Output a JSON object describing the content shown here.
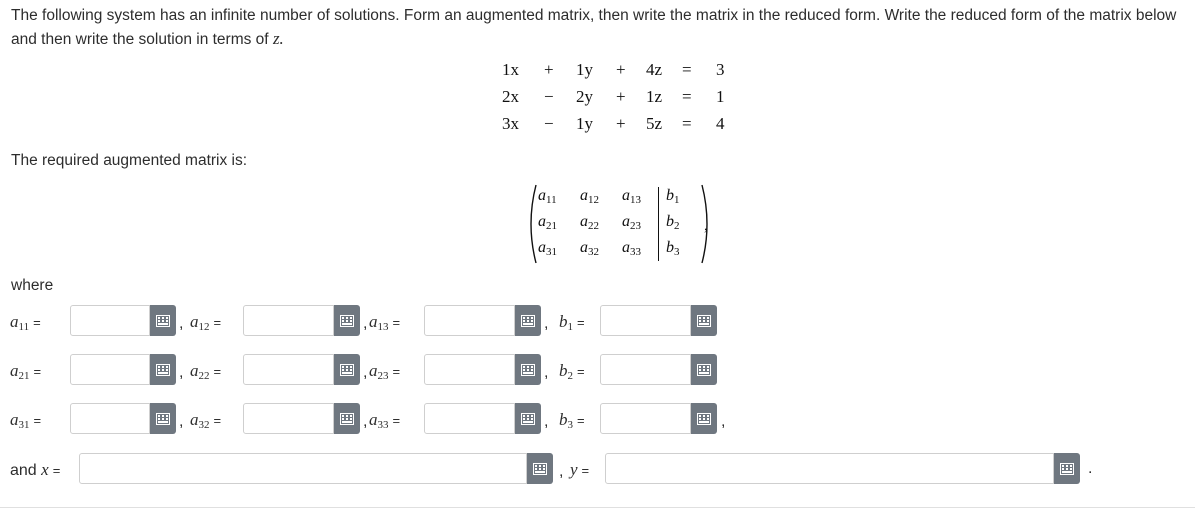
{
  "intro": "The following system has an infinite number of solutions. Form an augmented matrix, then write the matrix in the reduced form. Write the reduced form of the matrix below and then write the solution in terms of",
  "intro_var": "z.",
  "equations": [
    {
      "a": "1x",
      "op1": "+",
      "b": "1y",
      "op2": "+",
      "c": "4z",
      "eq": "=",
      "rhs": "3"
    },
    {
      "a": "2x",
      "op1": "−",
      "b": "2y",
      "op2": "+",
      "c": "1z",
      "eq": "=",
      "rhs": "1"
    },
    {
      "a": "3x",
      "op1": "−",
      "b": "1y",
      "op2": "+",
      "c": "5z",
      "eq": "=",
      "rhs": "4"
    }
  ],
  "required_label": "The required augmented matrix is:",
  "matrix": {
    "rows": [
      [
        "a11",
        "a12",
        "a13",
        "b1"
      ],
      [
        "a21",
        "a22",
        "a23",
        "b2"
      ],
      [
        "a31",
        "a32",
        "a33",
        "b3"
      ]
    ],
    "trailing": ","
  },
  "where_label": "where",
  "inputs": {
    "a11": "",
    "a12": "",
    "a13": "",
    "b1": "",
    "a21": "",
    "a22": "",
    "a23": "",
    "b2": "",
    "a31": "",
    "a32": "",
    "a33": "",
    "b3": "",
    "x": "",
    "y": ""
  },
  "labels": {
    "and": "and",
    "x_var": "x",
    "y_var": "y",
    "equals": "=",
    "comma": ",",
    "period": "."
  },
  "icons": {
    "keyboard_button": "keypad-icon"
  },
  "colors": {
    "keypad_button_bg": "#6f7780",
    "field_border": "#cfcfcf",
    "text": "#2d2d2d"
  }
}
